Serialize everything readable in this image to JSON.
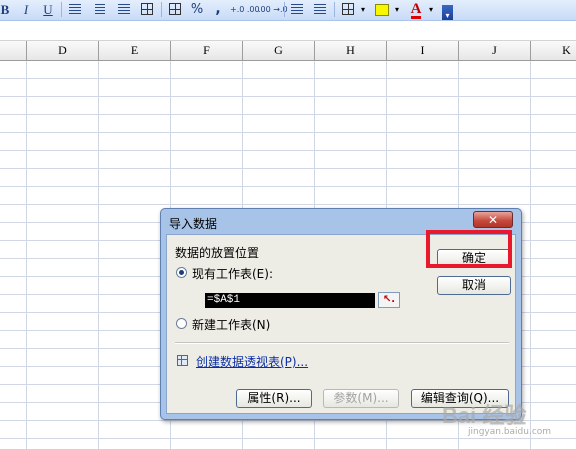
{
  "toolbar": {
    "bold": "B",
    "italic": "I",
    "underline": "U",
    "percent": "%",
    "comma": ",",
    "inc_decimal": "+.0 .00",
    "dec_decimal": ".00 →.0",
    "font_color_glyph": "A",
    "caret": "▾",
    "overflow": "▾"
  },
  "columns": [
    "D",
    "E",
    "F",
    "G",
    "H",
    "I",
    "J",
    "K"
  ],
  "dialog": {
    "title": "导入数据",
    "close": "✕",
    "placement_label": "数据的放置位置",
    "existing_sheet": "现有工作表(E):",
    "range_value": "=$A$1",
    "range_picker": "↖.",
    "new_sheet": "新建工作表(N)",
    "pivot_link": "创建数据透视表(P)...",
    "buttons": {
      "ok": "确定",
      "cancel": "取消",
      "properties": "属性(R)...",
      "parameters": "参数(M)...",
      "edit_query": "编辑查询(Q)..."
    }
  },
  "watermark": {
    "brand": "Bai 经验",
    "url": "jingyan.baidu.com"
  },
  "colors": {
    "highlight": "#e8192c",
    "dialog_frame": "#a7c3e8",
    "link": "#0b2fa5"
  }
}
